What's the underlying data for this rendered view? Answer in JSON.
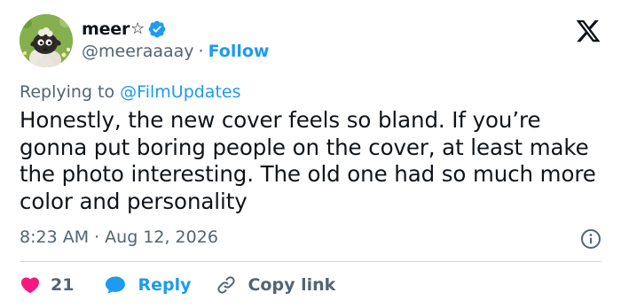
{
  "author": {
    "display_name": "meer",
    "name_symbol": "☆",
    "handle": "@meeraaaay",
    "separator": "·",
    "follow_label": "Follow",
    "verified": true,
    "verified_color": "#1d9bf0"
  },
  "reply_context": {
    "prefix": "Replying to",
    "mention": "@FilmUpdates"
  },
  "tweet": {
    "text": "Honestly, the new cover feels so bland. If you’re gonna put boring people on the cover, at least make the photo interesting. The old one had so much more color and personality",
    "time": "8:23 AM",
    "separator": "·",
    "date": "Aug 12, 2026"
  },
  "actions": {
    "like_count": "21",
    "like_color": "#f91880",
    "reply_label": "Reply",
    "copy_link_label": "Copy link"
  },
  "icons": {
    "brand": "x-logo-icon",
    "info": "info-icon",
    "like": "heart-icon",
    "reply": "speech-bubble-icon",
    "copy": "link-icon"
  },
  "colors": {
    "text": "#0f1419",
    "secondary_text": "#536471",
    "accent": "#1d9bf0",
    "divider": "#cfd9de"
  }
}
